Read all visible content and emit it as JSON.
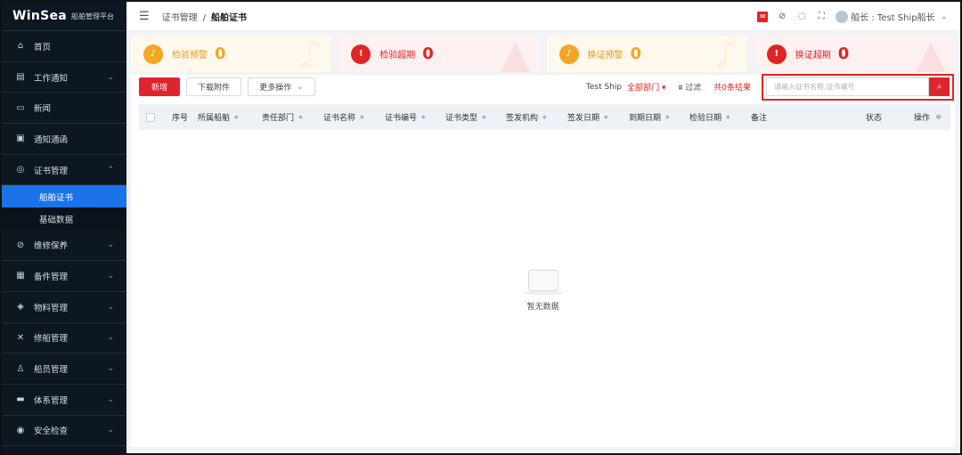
{
  "brand": {
    "logo": "WinSea",
    "sub": "船舶管理平台"
  },
  "sidebar": {
    "items": [
      {
        "label": "首页",
        "icon": "home-icon",
        "glyph": "⌂",
        "chevron": false
      },
      {
        "label": "工作通知",
        "icon": "notice-icon",
        "glyph": "▤",
        "chevron": true
      },
      {
        "label": "新闻",
        "icon": "news-icon",
        "glyph": "▭",
        "chevron": false
      },
      {
        "label": "通知通函",
        "icon": "circular-icon",
        "glyph": "▣",
        "chevron": false
      },
      {
        "label": "证书管理",
        "icon": "certificate-icon",
        "glyph": "◎",
        "chevron": true,
        "expanded": true
      },
      {
        "label": "维修保养",
        "icon": "maintenance-icon",
        "glyph": "⊘",
        "chevron": true
      },
      {
        "label": "备件管理",
        "icon": "spare-parts-icon",
        "glyph": "▦",
        "chevron": true
      },
      {
        "label": "物料管理",
        "icon": "materials-icon",
        "glyph": "◈",
        "chevron": true
      },
      {
        "label": "修船管理",
        "icon": "ship-repair-icon",
        "glyph": "✕",
        "chevron": true
      },
      {
        "label": "船员管理",
        "icon": "crew-icon",
        "glyph": "♙",
        "chevron": true
      },
      {
        "label": "体系管理",
        "icon": "system-icon",
        "glyph": "▬",
        "chevron": true
      },
      {
        "label": "安全检查",
        "icon": "safety-icon",
        "glyph": "◉",
        "chevron": true
      }
    ],
    "sub_items": [
      {
        "label": "船舶证书",
        "active": true
      },
      {
        "label": "基础数据",
        "active": false
      }
    ]
  },
  "header": {
    "breadcrumb_parent": "证书管理",
    "breadcrumb_sep": "/",
    "breadcrumb_current": "船舶证书",
    "user": "船长 : Test Ship船长"
  },
  "stats": [
    {
      "label": "检验预警",
      "value": "0",
      "type": "warn"
    },
    {
      "label": "检验超期",
      "value": "0",
      "type": "err"
    },
    {
      "label": "换证预警",
      "value": "0",
      "type": "warn"
    },
    {
      "label": "换证超期",
      "value": "0",
      "type": "err"
    }
  ],
  "toolbar": {
    "new_label": "新增",
    "download_label": "下载附件",
    "more_label": "更多操作",
    "ship": "Test Ship",
    "dept": "全部部门",
    "filter": "过滤",
    "count": "共0条结果",
    "search_placeholder": "请输入证书名称,证书编号"
  },
  "table": {
    "columns": [
      "序号",
      "所属船舶",
      "责任部门",
      "证书名称",
      "证书编号",
      "证书类型",
      "签发机构",
      "签发日期",
      "到期日期",
      "检验日期",
      "备注",
      "状态",
      "操作"
    ]
  },
  "empty_text": "暂无数据",
  "colors": {
    "accent": "#e0242f",
    "active_menu": "#1a73e8",
    "sidebar_bg": "#0c1722",
    "warn": "#f5a623"
  }
}
